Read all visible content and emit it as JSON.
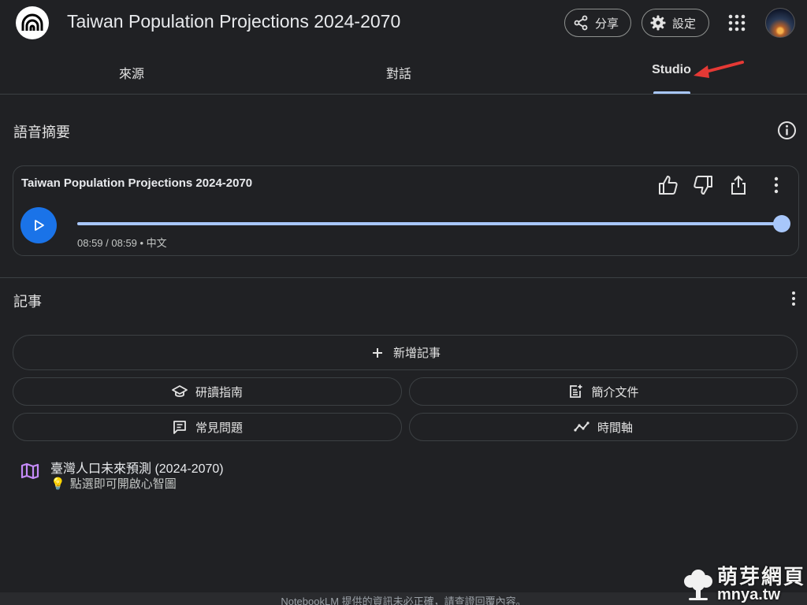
{
  "header": {
    "title": "Taiwan Population Projections 2024-2070",
    "share_label": "分享",
    "settings_label": "設定"
  },
  "tabs": [
    {
      "label": "來源"
    },
    {
      "label": "對話"
    },
    {
      "label": "Studio",
      "active": true
    }
  ],
  "audio_overview": {
    "section_title": "語音摘要",
    "card_title": "Taiwan Population Projections 2024-2070",
    "time": "08:59 / 08:59 • 中文",
    "progress_fraction": 1.0
  },
  "notes": {
    "section_title": "記事",
    "add_note_label": "新增記事",
    "quick_actions": [
      {
        "label": "研讀指南",
        "icon": "school-icon"
      },
      {
        "label": "簡介文件",
        "icon": "post-add-icon"
      },
      {
        "label": "常見問題",
        "icon": "quiz-icon"
      },
      {
        "label": "時間軸",
        "icon": "timeline-icon"
      }
    ],
    "items": [
      {
        "title": "臺灣人口未來預測 (2024-2070)",
        "hint": "點選即可開啟心智圖",
        "icon": "map-icon"
      }
    ]
  },
  "footer": {
    "disclaimer": "NotebookLM 提供的資訊未必正確，請查證回覆內容。"
  },
  "watermark": {
    "name": "萌芽網頁",
    "url": "mnya.tw"
  },
  "colors": {
    "background": "#202124",
    "accent": "#a8c7fa",
    "play_button": "#1a73e8",
    "map_icon": "#c58af9",
    "annotation_arrow": "#e53935"
  }
}
